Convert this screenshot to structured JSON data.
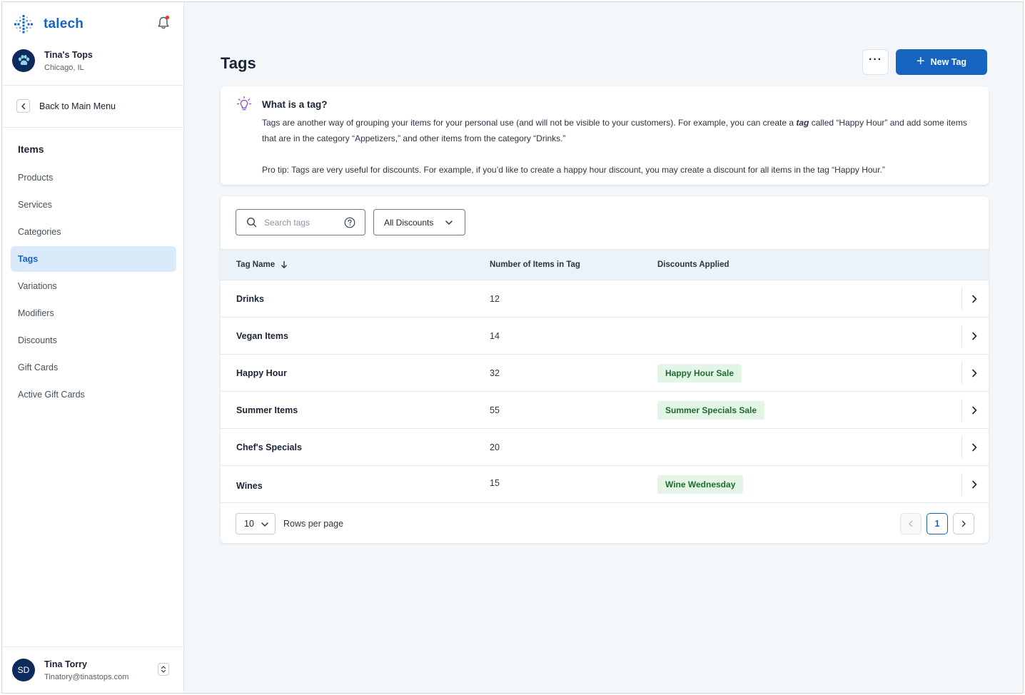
{
  "app": {
    "brand": "talech"
  },
  "account": {
    "name": "Tina's Tops",
    "location": "Chicago, IL"
  },
  "sidebar": {
    "back_label": "Back to Main Menu",
    "section_title": "Items",
    "items": [
      {
        "label": "Products",
        "active": false
      },
      {
        "label": "Services",
        "active": false
      },
      {
        "label": "Categories",
        "active": false
      },
      {
        "label": "Tags",
        "active": true
      },
      {
        "label": "Variations",
        "active": false
      },
      {
        "label": "Modifiers",
        "active": false
      },
      {
        "label": "Discounts",
        "active": false
      },
      {
        "label": "Gift Cards",
        "active": false
      },
      {
        "label": "Active Gift Cards",
        "active": false
      }
    ]
  },
  "user": {
    "initials": "SD",
    "name": "Tina Torry",
    "email": "Tinatory@tinastops.com"
  },
  "header": {
    "title": "Tags",
    "more_label": "···",
    "new_button": "New Tag"
  },
  "info": {
    "title": "What is a tag?",
    "body_before": "Tags are another way of grouping your items for your personal use (and will not be visible to your customers). For example, you can create a ",
    "body_emphasis": "tag",
    "body_after": " called “Happy Hour” and add some items that are in the category “Appetizers,” and other items from the category “Drinks.”",
    "tip": "Pro tip: Tags are very useful for discounts. For example, if you’d like to create a happy hour discount, you may create a discount for all items in the tag “Happy Hour.”"
  },
  "filters": {
    "search_placeholder": "Search tags",
    "search_value": "",
    "discount_filter": "All Discounts"
  },
  "table": {
    "columns": {
      "name": "Tag Name",
      "count": "Number of Items in Tag",
      "discounts": "Discounts Applied"
    },
    "rows": [
      {
        "name": "Drinks",
        "count": "12",
        "discount": ""
      },
      {
        "name": "Vegan Items",
        "count": "14",
        "discount": ""
      },
      {
        "name": "Happy Hour",
        "count": "32",
        "discount": "Happy Hour Sale"
      },
      {
        "name": "Summer Items",
        "count": "55",
        "discount": "Summer Specials Sale"
      },
      {
        "name": "Chef's Specials",
        "count": "20",
        "discount": ""
      },
      {
        "name": "Wines",
        "count": "15",
        "discount": "Wine Wednesday"
      }
    ]
  },
  "pagination": {
    "rows_per_page": "10",
    "rows_label": "Rows per page",
    "current_page": "1"
  },
  "colors": {
    "brand": "#1565c0",
    "active_nav_bg": "#dbeafa",
    "badge_bg": "#e3f5e6",
    "badge_text": "#1e6b2e",
    "notification_dot": "#e53935"
  }
}
